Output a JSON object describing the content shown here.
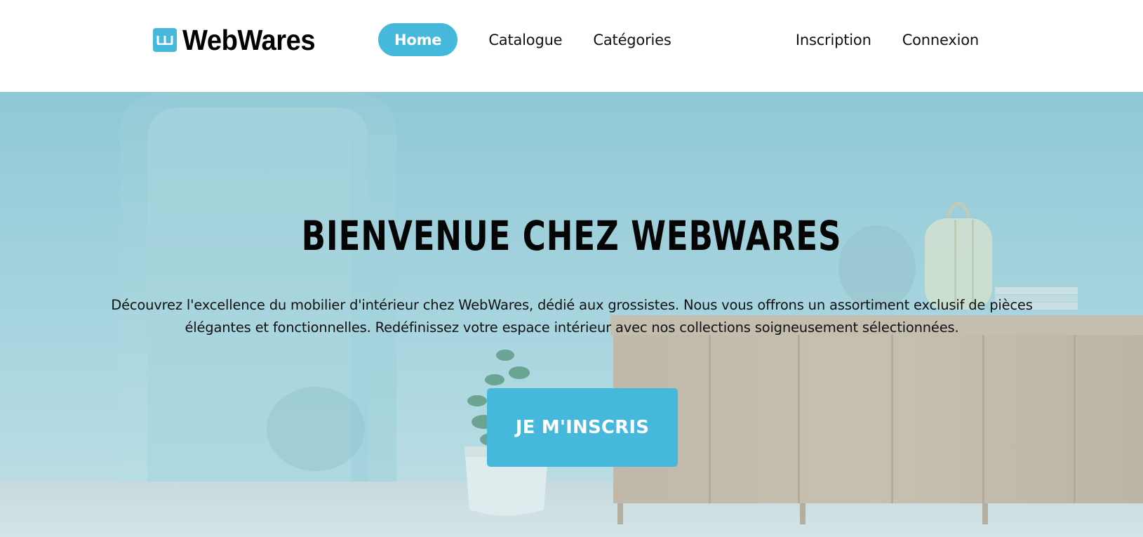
{
  "header": {
    "logo_mark": "w",
    "logo_text": "WebWares",
    "nav": [
      {
        "label": "Home",
        "active": true
      },
      {
        "label": "Catalogue",
        "active": false
      },
      {
        "label": "Catégories",
        "active": false
      }
    ],
    "account_nav": [
      {
        "label": "Inscription"
      },
      {
        "label": "Connexion"
      }
    ]
  },
  "hero": {
    "title": "BIENVENUE CHEZ WEBWARES",
    "description": "Découvrez l'excellence du mobilier d'intérieur chez WebWares, dédié aux grossistes. Nous vous offrons un assortiment exclusif de pièces élégantes et fonctionnelles. Redéfinissez votre espace intérieur avec nos collections soigneusement sélectionnées.",
    "cta_label": "JE M'INSCRIS"
  },
  "colors": {
    "accent": "#45b8dc",
    "header_bg": "#ffffff",
    "text": "#000000"
  },
  "icons": {
    "logo": "webwares-logo-icon"
  }
}
